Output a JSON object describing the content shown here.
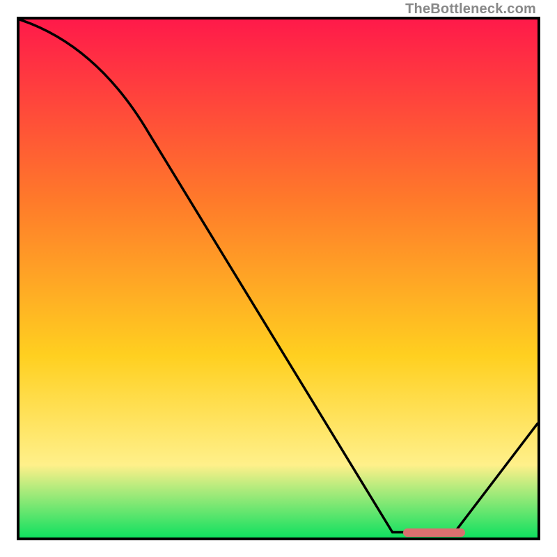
{
  "watermark": "TheBottleneck.com",
  "colors": {
    "top": "#ff1a4a",
    "mid1": "#ff7a2a",
    "mid2": "#ffd020",
    "mid3": "#fff08a",
    "bottom": "#10e060",
    "marker": "#d96f6f",
    "curve": "#000000"
  },
  "chart_data": {
    "type": "line",
    "title": "",
    "xlabel": "",
    "ylabel": "",
    "xlim": [
      0,
      100
    ],
    "ylim": [
      0,
      100
    ],
    "grid": false,
    "series": [
      {
        "name": "curve",
        "x": [
          0,
          25,
          72,
          84,
          100
        ],
        "values": [
          100,
          78,
          1,
          1,
          22
        ]
      }
    ],
    "highlight_band": {
      "x_start": 74,
      "x_end": 86,
      "y": 1
    }
  }
}
